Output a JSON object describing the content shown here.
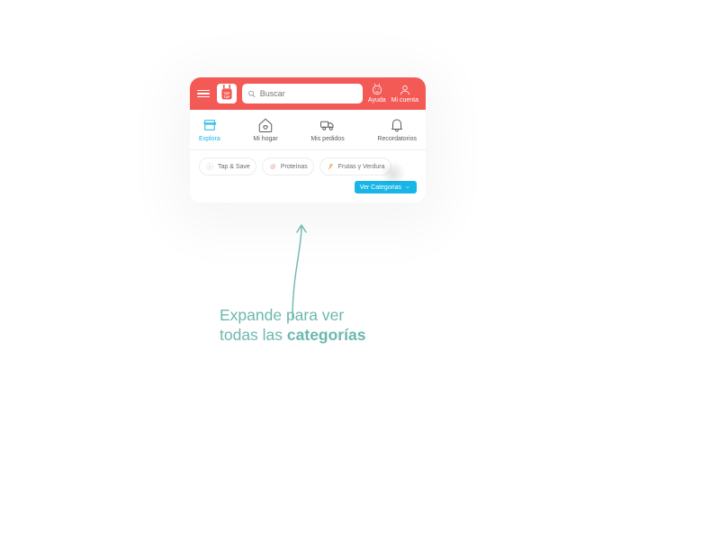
{
  "topbar": {
    "search_placeholder": "Buscar",
    "help_label": "Ayuda",
    "account_label": "Mi cuenta",
    "logo_text": "TAP TAP"
  },
  "nav": {
    "items": [
      {
        "label": "Explora",
        "active": true
      },
      {
        "label": "Mi hogar"
      },
      {
        "label": "Mis pedidos"
      },
      {
        "label": "Recordatorios"
      }
    ]
  },
  "chips": {
    "items": [
      {
        "label": "Tap & Save"
      },
      {
        "label": "Proteínas"
      },
      {
        "label": "Frutas y Verdura"
      }
    ]
  },
  "cta": {
    "label": "Ver Categorias"
  },
  "caption": {
    "line1": "Expande para ver",
    "line2_a": "todas las ",
    "line2_b": "categorías"
  },
  "colors": {
    "accent_red": "#F35A56",
    "accent_blue": "#18B6E6",
    "caption": "#6CB8AE"
  }
}
